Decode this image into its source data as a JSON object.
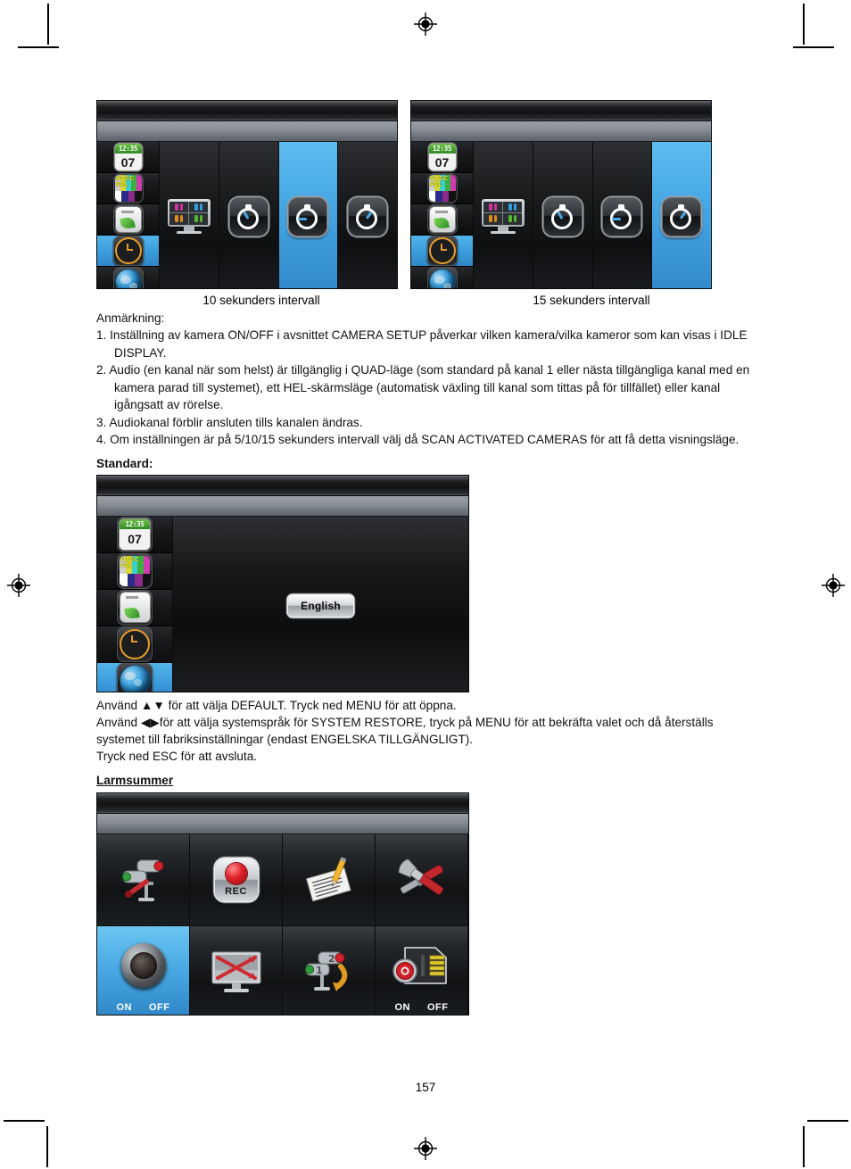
{
  "document": {
    "page_number": "157",
    "language": "sv"
  },
  "panels": {
    "interval_10": {
      "caption": "10 sekunders intervall",
      "rail_items": [
        {
          "name": "calendar-clock",
          "time": "12:35",
          "day": "07"
        },
        {
          "name": "ntsc-pal",
          "labels": [
            "NTSC",
            "PAL"
          ]
        },
        {
          "name": "eco-battery"
        },
        {
          "name": "timer-clock",
          "selected": true
        },
        {
          "name": "globe-language"
        }
      ],
      "columns": [
        {
          "name": "quad-view",
          "selected": false
        },
        {
          "name": "stopwatch-5s",
          "selected": false
        },
        {
          "name": "stopwatch-10s",
          "selected": true
        },
        {
          "name": "stopwatch-15s",
          "selected": false
        }
      ]
    },
    "interval_15": {
      "caption": "15 sekunders intervall",
      "rail_items": [
        {
          "name": "calendar-clock",
          "time": "12:35",
          "day": "07"
        },
        {
          "name": "ntsc-pal",
          "labels": [
            "NTSC",
            "PAL"
          ]
        },
        {
          "name": "eco-battery"
        },
        {
          "name": "timer-clock",
          "selected": true
        },
        {
          "name": "globe-language"
        }
      ],
      "columns": [
        {
          "name": "quad-view",
          "selected": false
        },
        {
          "name": "stopwatch-5s",
          "selected": false
        },
        {
          "name": "stopwatch-10s",
          "selected": false
        },
        {
          "name": "stopwatch-15s",
          "selected": true
        }
      ]
    },
    "standard": {
      "heading": "Standard:",
      "rail_items": [
        {
          "name": "calendar-clock",
          "time": "12:35",
          "day": "07"
        },
        {
          "name": "ntsc-pal",
          "labels": [
            "NTSC",
            "PAL"
          ]
        },
        {
          "name": "eco-battery"
        },
        {
          "name": "timer-clock"
        },
        {
          "name": "globe-language",
          "selected": true
        }
      ],
      "language_button": "English"
    },
    "larmsummer": {
      "heading": "Larmsummer",
      "cells": [
        {
          "name": "camera-setup-icon",
          "selected": false,
          "onoff": null
        },
        {
          "name": "record-icon",
          "label": "REC",
          "selected": false,
          "onoff": null
        },
        {
          "name": "notepad-pen-icon",
          "selected": false,
          "onoff": null
        },
        {
          "name": "tools-icon",
          "selected": false,
          "onoff": null
        },
        {
          "name": "speaker-alarm-icon",
          "selected": true,
          "onoff": [
            "ON",
            "OFF"
          ]
        },
        {
          "name": "monitor-off-icon",
          "selected": false,
          "onoff": null
        },
        {
          "name": "camera-scan-icon",
          "selected": false,
          "onoff": null
        },
        {
          "name": "sd-card-record-icon",
          "selected": false,
          "onoff": [
            "ON",
            "OFF"
          ]
        }
      ]
    }
  },
  "notes": {
    "title": "Anmärkning:",
    "items": [
      "1. Inställning av kamera ON/OFF i avsnittet CAMERA SETUP påverkar vilken kamera/vilka kameror som kan visas i IDLE DISPLAY.",
      "2. Audio (en kanal när som helst) är tillgänglig i QUAD-läge (som standard på kanal 1 eller nästa tillgängliga kanal med en kamera parad till systemet), ett HEL-skärmsläge (automatisk växling till kanal som tittas på för tillfället) eller kanal igångsatt av rörelse.",
      "3. Audiokanal förblir ansluten tills kanalen ändras.",
      "4. Om inställningen är på 5/10/15 sekunders intervall välj då SCAN ACTIVATED CAMERAS för att få detta visningsläge."
    ]
  },
  "standard_instructions": {
    "line1": "Använd ▲▼ för att välja DEFAULT. Tryck ned MENU för att öppna.",
    "line2": "Använd ◀▶för att välja systemspråk för SYSTEM RESTORE, tryck på MENU för att bekräfta valet och då återställs systemet till fabriksinställningar (endast ENGELSKA TILLGÄNGLIGT).",
    "line3": "Tryck ned ESC för att avsluta."
  },
  "colors": {
    "selection_blue": "#3d9ede",
    "panel_dark": "#121212",
    "accent_orange": "#e89c28",
    "rec_red": "#d81f26"
  }
}
